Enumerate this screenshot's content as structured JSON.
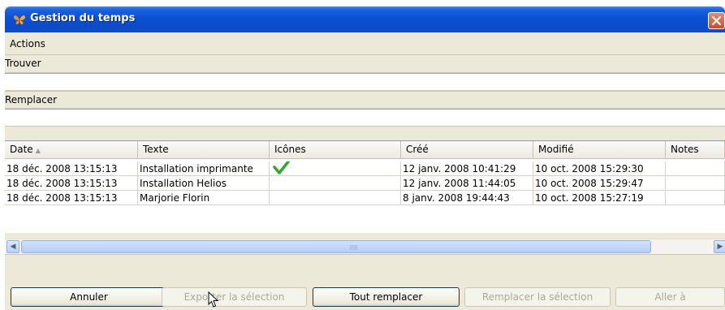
{
  "window": {
    "title": "Gestion du temps"
  },
  "bands": {
    "actions": "Actions",
    "find_label": "Trouver",
    "replace_label": "Remplacer"
  },
  "fields": {
    "find_value": "",
    "replace_value": ""
  },
  "table": {
    "columns": [
      "Date",
      "Texte",
      "Icônes",
      "Créé",
      "Modifié",
      "Notes"
    ],
    "rows": [
      {
        "date": "18 déc. 2008 13:15:13",
        "texte": "Installation imprimante",
        "icon": "checkmark-icon",
        "cree": "12 janv. 2008 10:41:29",
        "modifie": "10 oct. 2008 15:29:30",
        "notes": ""
      },
      {
        "date": "18 déc. 2008 13:15:13",
        "texte": "Installation Helios",
        "icon": "",
        "cree": "12 janv. 2008 11:44:05",
        "modifie": "10 oct. 2008 15:29:47",
        "notes": ""
      },
      {
        "date": "18 déc. 2008 13:15:13",
        "texte": "Marjorie Florin",
        "icon": "",
        "cree": "8 janv. 2008 19:44:43",
        "modifie": "10 oct. 2008 15:27:19",
        "notes": ""
      }
    ]
  },
  "buttons": {
    "cancel": "Annuler",
    "export": "Exporter la sélection",
    "replace_all": "Tout remplacer",
    "replace_selection": "Remplacer la sélection",
    "goto": "Aller à"
  },
  "colors": {
    "titlebar": "#0b52d6",
    "checkmark": "#2fa82f",
    "close_button": "#cf4a2a"
  }
}
